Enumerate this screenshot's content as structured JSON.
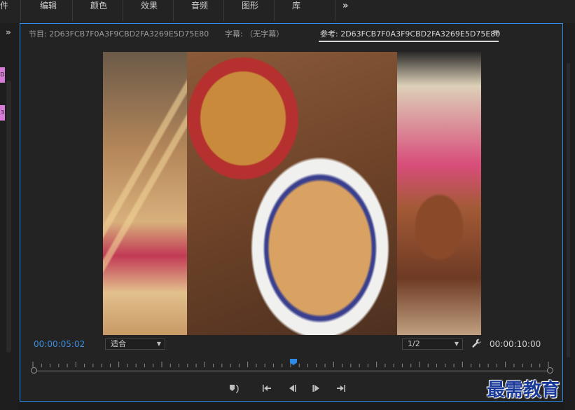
{
  "menu": [
    "件",
    "编辑",
    "颜色",
    "效果",
    "音频",
    "图形",
    "库"
  ],
  "left_panel": {
    "tab_a": "D",
    "tab_b": "3"
  },
  "monitor": {
    "tabs": {
      "program": "节目: 2D63FCB7F0A3F9CBD2FA3269E5D75E80",
      "captions": "字幕: （无字幕）",
      "reference": "参考: 2D63FCB7F0A3F9CBD2FA3269E5D75E80"
    },
    "current_timecode": "00:00:05:02",
    "fit_option": "适合",
    "resolution_option": "1/2",
    "duration_timecode": "00:00:10:00"
  },
  "icons": {
    "menu_overflow": "double-chevron-right-icon",
    "panel_menu": "hamburger-icon",
    "settings": "wrench-icon",
    "controls": [
      "marker-icon",
      "go-to-in-icon",
      "step-back-icon",
      "step-forward-icon",
      "go-to-out-icon"
    ]
  },
  "colors": {
    "accent": "#2d8ceb",
    "label": "#d77bd7"
  },
  "watermark": "最需教育"
}
